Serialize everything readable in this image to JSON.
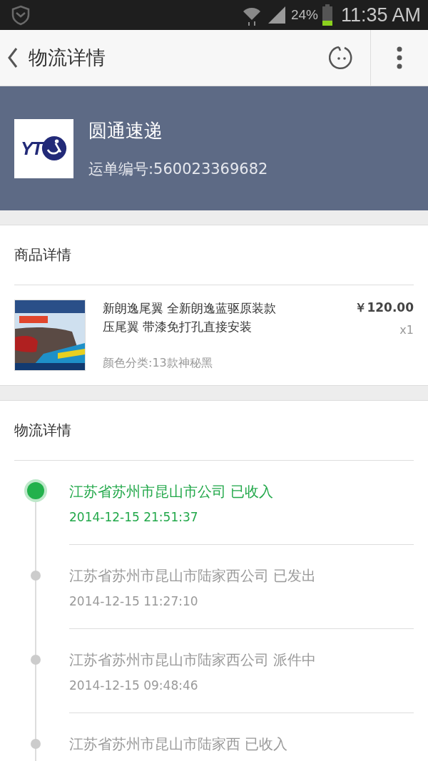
{
  "status_bar": {
    "battery": "24%",
    "time": "11:35 AM"
  },
  "app_bar": {
    "title": "物流详情"
  },
  "carrier": {
    "logo": "YT",
    "name": "圆通速递",
    "tracking": "运单编号:560023369682"
  },
  "goods": {
    "heading": "商品详情",
    "item": {
      "kind": "picture",
      "title": "新朗逸尾翼 全新朗逸蓝驱原装款压尾翼 带漆免打孔直接安装",
      "variant": "颜色分类:13款神秘黑",
      "price": "￥120.00",
      "quantity": "x1"
    }
  },
  "logistics": {
    "heading": "物流详情",
    "events": [
      {
        "text": "江苏省苏州市昆山市公司 已收入",
        "time": "2014-12-15 21:51:37",
        "current": true
      },
      {
        "text": "江苏省苏州市昆山市陆家西公司 已发出",
        "time": "2014-12-15 11:27:10",
        "current": false
      },
      {
        "text": "江苏省苏州市昆山市陆家西公司 派件中",
        "time": "2014-12-15 09:48:46",
        "current": false
      },
      {
        "text": "江苏省苏州市昆山市陆家西 已收入",
        "current": false
      }
    ]
  }
}
